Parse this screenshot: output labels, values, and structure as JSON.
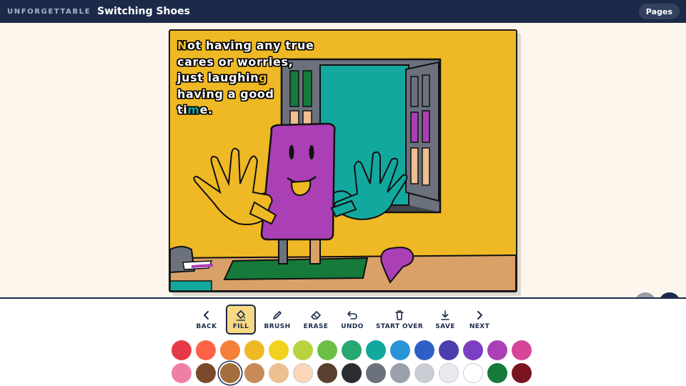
{
  "header": {
    "brand": "UNFORGETTABLE",
    "title": "Switching Shoes",
    "pages_label": "Pages"
  },
  "page": {
    "story_lines": [
      "Not having any true",
      "cares or worries,",
      "just laughing",
      "having a good",
      "time."
    ]
  },
  "zoom": {
    "out_label": "−",
    "in_label": "+"
  },
  "toolbar": {
    "back_label": "BACK",
    "fill_label": "FILL",
    "brush_label": "BRUSH",
    "erase_label": "ERASE",
    "undo_label": "UNDO",
    "start_over_label": "START OVER",
    "save_label": "SAVE",
    "next_label": "NEXT",
    "active_tool": "FILL"
  },
  "palette": {
    "selected_color": "#a66d3d",
    "colors": [
      "#e63946",
      "#ff6347",
      "#f5803a",
      "#efb925",
      "#f2d11f",
      "#b9d23f",
      "#6cbf45",
      "#27a86f",
      "#13a89e",
      "#2a94d6",
      "#2d5fc4",
      "#4b3fad",
      "#7b3fc4",
      "#ab3fb5",
      "#d6459a",
      "#f07fa8",
      "#7a4a2b",
      "#a66d3d",
      "#c78a58",
      "#eebf91",
      "#f9d7b8",
      "#5a4030",
      "#2b2d33",
      "#6b717d",
      "#9ba1ab",
      "#c9ccd3",
      "#e7e9ee",
      "#ffffff",
      "#157a3a",
      "#7a1420"
    ]
  }
}
